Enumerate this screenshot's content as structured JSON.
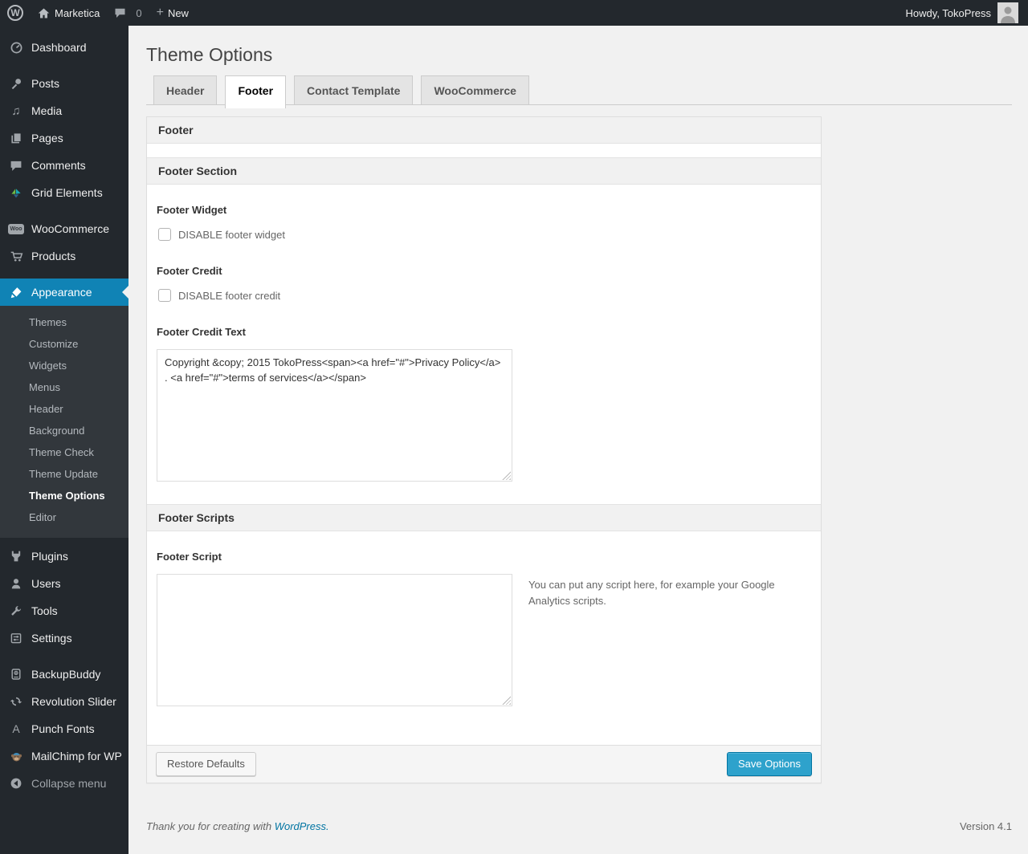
{
  "admin_bar": {
    "site_name": "Marketica",
    "comment_count": "0",
    "new_label": "New",
    "howdy_text": "Howdy, TokoPress"
  },
  "sidebar": {
    "items": [
      {
        "label": "Dashboard"
      },
      {
        "label": "Posts"
      },
      {
        "label": "Media"
      },
      {
        "label": "Pages"
      },
      {
        "label": "Comments"
      },
      {
        "label": "Grid Elements"
      },
      {
        "label": "WooCommerce"
      },
      {
        "label": "Products"
      },
      {
        "label": "Appearance"
      },
      {
        "label": "Plugins"
      },
      {
        "label": "Users"
      },
      {
        "label": "Tools"
      },
      {
        "label": "Settings"
      },
      {
        "label": "BackupBuddy"
      },
      {
        "label": "Revolution Slider"
      },
      {
        "label": "Punch Fonts"
      },
      {
        "label": "MailChimp for WP"
      },
      {
        "label": "Collapse menu"
      }
    ],
    "woo_badge": "Woo",
    "punch_fonts_glyph": "A",
    "appearance_submenu": [
      {
        "label": "Themes"
      },
      {
        "label": "Customize"
      },
      {
        "label": "Widgets"
      },
      {
        "label": "Menus"
      },
      {
        "label": "Header"
      },
      {
        "label": "Background"
      },
      {
        "label": "Theme Check"
      },
      {
        "label": "Theme Update"
      },
      {
        "label": "Theme Options"
      },
      {
        "label": "Editor"
      }
    ]
  },
  "page": {
    "title": "Theme Options",
    "tabs": [
      {
        "label": "Header"
      },
      {
        "label": "Footer"
      },
      {
        "label": "Contact Template"
      },
      {
        "label": "WooCommerce"
      }
    ]
  },
  "panel": {
    "footer_box_label": "Footer",
    "footer_section_label": "Footer Section",
    "footer_widget_label": "Footer Widget",
    "footer_widget_checkbox_label": "DISABLE footer widget",
    "footer_credit_label": "Footer Credit",
    "footer_credit_checkbox_label": "DISABLE footer credit",
    "footer_credit_text_label": "Footer Credit Text",
    "footer_credit_text_value": "Copyright &copy; 2015 TokoPress<span><a href=\"#\">Privacy Policy</a> . <a href=\"#\">terms of services</a></span>",
    "footer_scripts_label": "Footer Scripts",
    "footer_script_label": "Footer Script",
    "footer_script_value": "",
    "footer_script_description": "You can put any script here, for example your Google Analytics scripts.",
    "restore_button_label": "Restore Defaults",
    "save_button_label": "Save Options"
  },
  "page_footer": {
    "thanks_text": "Thank you for creating with ",
    "wordpress_link": "WordPress.",
    "version": "Version 4.1"
  },
  "colors": {
    "accent_blue": "#1083b5",
    "primary_button": "#2ea2cc",
    "dark_bar": "#23282d",
    "page_background": "#f1f1f1"
  }
}
